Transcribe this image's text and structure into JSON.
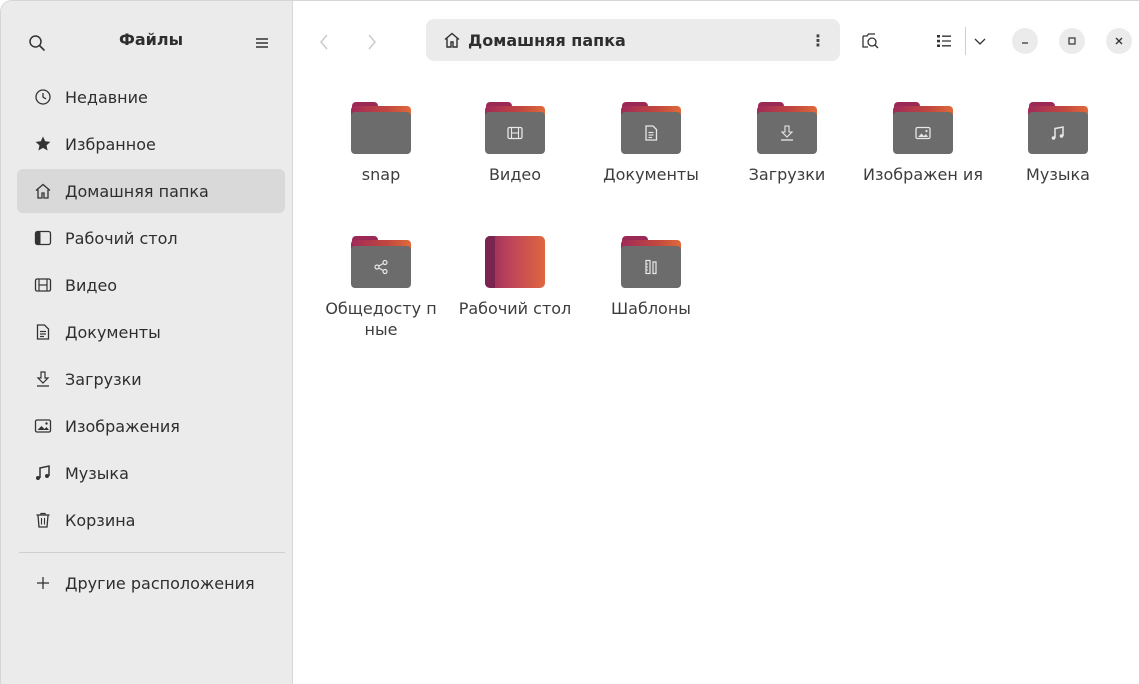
{
  "sidebar": {
    "title": "Файлы",
    "items": [
      {
        "label": "Недавние",
        "icon": "clock-icon"
      },
      {
        "label": "Избранное",
        "icon": "star-icon"
      },
      {
        "label": "Домашняя папка",
        "icon": "home-icon",
        "active": true
      },
      {
        "label": "Рабочий стол",
        "icon": "desktop-icon"
      },
      {
        "label": "Видео",
        "icon": "film-icon"
      },
      {
        "label": "Документы",
        "icon": "document-icon"
      },
      {
        "label": "Загрузки",
        "icon": "download-icon"
      },
      {
        "label": "Изображения",
        "icon": "image-icon"
      },
      {
        "label": "Музыка",
        "icon": "music-icon"
      },
      {
        "label": "Корзина",
        "icon": "trash-icon"
      }
    ],
    "other": {
      "label": "Другие расположения",
      "icon": "plus-icon"
    }
  },
  "header": {
    "path_label": "Домашняя папка",
    "path_menu_glyph": "⋮"
  },
  "files": [
    {
      "label": "snap",
      "emblem": "none"
    },
    {
      "label": "Видео",
      "emblem": "film-icon"
    },
    {
      "label": "Документы",
      "emblem": "document-icon"
    },
    {
      "label": "Загрузки",
      "emblem": "download-icon"
    },
    {
      "label": "Изображен ия",
      "emblem": "image-icon"
    },
    {
      "label": "Музыка",
      "emblem": "music-icon"
    },
    {
      "label": "Общедосту пные",
      "emblem": "share-icon"
    },
    {
      "label": "Рабочий стол",
      "emblem": "desktop-gradient"
    },
    {
      "label": "Шаблоны",
      "emblem": "template-icon"
    }
  ],
  "colors": {
    "sidebar_bg": "#ebebeb",
    "active_bg": "#d9d9d9",
    "folder_front": "#6c6c6c",
    "folder_accent_start": "#a02a58",
    "folder_accent_end": "#e06a3a"
  }
}
